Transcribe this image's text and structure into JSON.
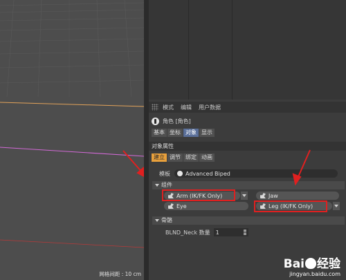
{
  "viewport": {
    "grid_status": "网格间距 : 10 cm",
    "colors": {
      "orange_line": "#e3a35a",
      "pink_line": "#d46ad8",
      "red_line": "#b83a3a",
      "annotation_arrow": "#e02020"
    }
  },
  "attribute_manager": {
    "menu": [
      "模式",
      "编辑",
      "用户数据"
    ],
    "object_name": "角色 [角色]",
    "object_tabs": [
      "基本",
      "坐标",
      "对象",
      "显示"
    ],
    "object_props_title": "对象属性",
    "sub_tabs": [
      "建立",
      "调节",
      "绑定",
      "动画"
    ],
    "template_label": "模板",
    "template_value": "Advanced Biped",
    "components_group": "组件",
    "components": {
      "arm": "Arm (IK/FK Only)",
      "jaw": "Jaw",
      "eye": "Eye",
      "leg": "Leg (IK/FK Only)"
    },
    "bones_group": "骨骼",
    "neck_label": "BLND_Neck 数量",
    "neck_value": "1"
  },
  "watermark": {
    "logo": "Bai",
    "logo_suffix": "经验",
    "url": "jingyan.baidu.com"
  }
}
